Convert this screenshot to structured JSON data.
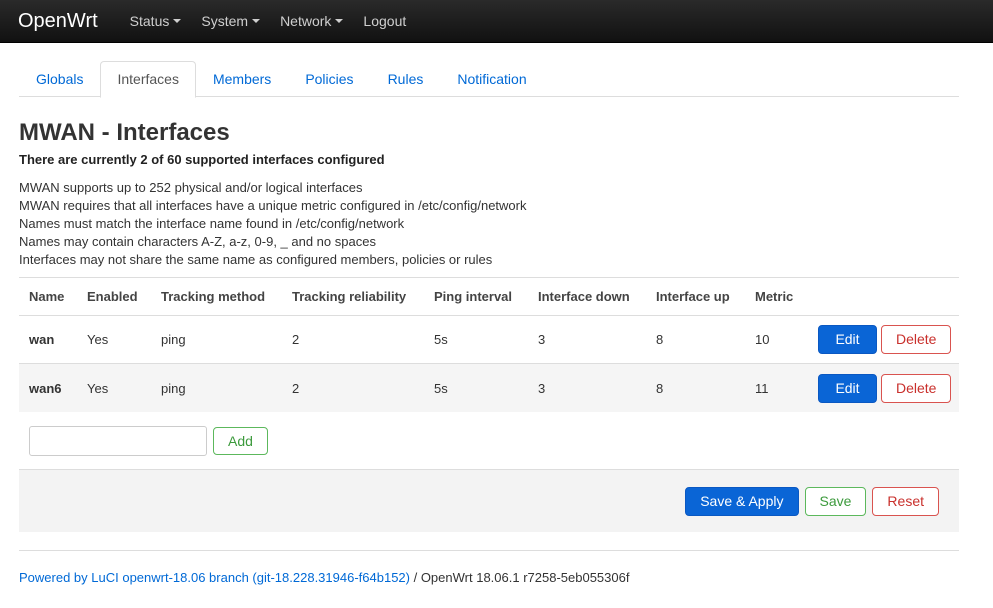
{
  "navbar": {
    "brand": "OpenWrt",
    "items": [
      {
        "label": "Status",
        "dropdown": true
      },
      {
        "label": "System",
        "dropdown": true
      },
      {
        "label": "Network",
        "dropdown": true
      },
      {
        "label": "Logout",
        "dropdown": false
      }
    ]
  },
  "tabs": [
    {
      "label": "Globals",
      "active": false
    },
    {
      "label": "Interfaces",
      "active": true
    },
    {
      "label": "Members",
      "active": false
    },
    {
      "label": "Policies",
      "active": false
    },
    {
      "label": "Rules",
      "active": false
    },
    {
      "label": "Notification",
      "active": false
    }
  ],
  "page": {
    "title": "MWAN - Interfaces",
    "subtitle": "There are currently 2 of 60 supported interfaces configured",
    "info": [
      "MWAN supports up to 252 physical and/or logical interfaces",
      "MWAN requires that all interfaces have a unique metric configured in /etc/config/network",
      "Names must match the interface name found in /etc/config/network",
      "Names may contain characters A-Z, a-z, 0-9, _ and no spaces",
      "Interfaces may not share the same name as configured members, policies or rules"
    ]
  },
  "table": {
    "headers": [
      "Name",
      "Enabled",
      "Tracking method",
      "Tracking reliability",
      "Ping interval",
      "Interface down",
      "Interface up",
      "Metric"
    ],
    "rows": [
      {
        "name": "wan",
        "enabled": "Yes",
        "tracking_method": "ping",
        "reliability": "2",
        "ping_interval": "5s",
        "down": "3",
        "up": "8",
        "metric": "10"
      },
      {
        "name": "wan6",
        "enabled": "Yes",
        "tracking_method": "ping",
        "reliability": "2",
        "ping_interval": "5s",
        "down": "3",
        "up": "8",
        "metric": "11"
      }
    ],
    "edit_label": "Edit",
    "delete_label": "Delete"
  },
  "add": {
    "input_value": "",
    "button_label": "Add"
  },
  "actions": {
    "save_apply": "Save & Apply",
    "save": "Save",
    "reset": "Reset"
  },
  "footer": {
    "link_text": "Powered by LuCI openwrt-18.06 branch (git-18.228.31946-f64b152)",
    "version_text": " / OpenWrt 18.06.1 r7258-5eb055306f"
  },
  "colors": {
    "primary": "#0a65d6",
    "link": "#0069d6",
    "danger": "#d9534f",
    "success": "#5cb85c"
  }
}
